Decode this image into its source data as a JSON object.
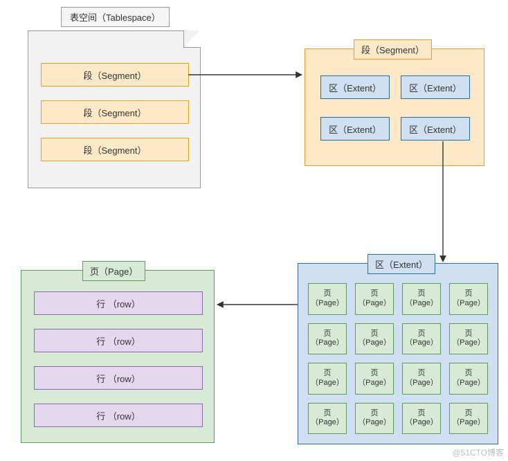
{
  "tablespace": {
    "label": "表空间（Tablespace）"
  },
  "tablespace_segments": [
    "段（Segment）",
    "段（Segment）",
    "段（Segment）"
  ],
  "segment": {
    "title": "段（Segment）",
    "extents": [
      "区（Extent）",
      "区（Extent）",
      "区（Extent）",
      "区（Extent）"
    ]
  },
  "extent": {
    "title": "区（Extent）",
    "page_label": "页\n（Page）",
    "page_count": 16
  },
  "page": {
    "title": "页（Page）",
    "rows": [
      "行 （row）",
      "行 （row）",
      "行 （row）",
      "行 （row）"
    ]
  },
  "watermark": "@51CTO博客"
}
